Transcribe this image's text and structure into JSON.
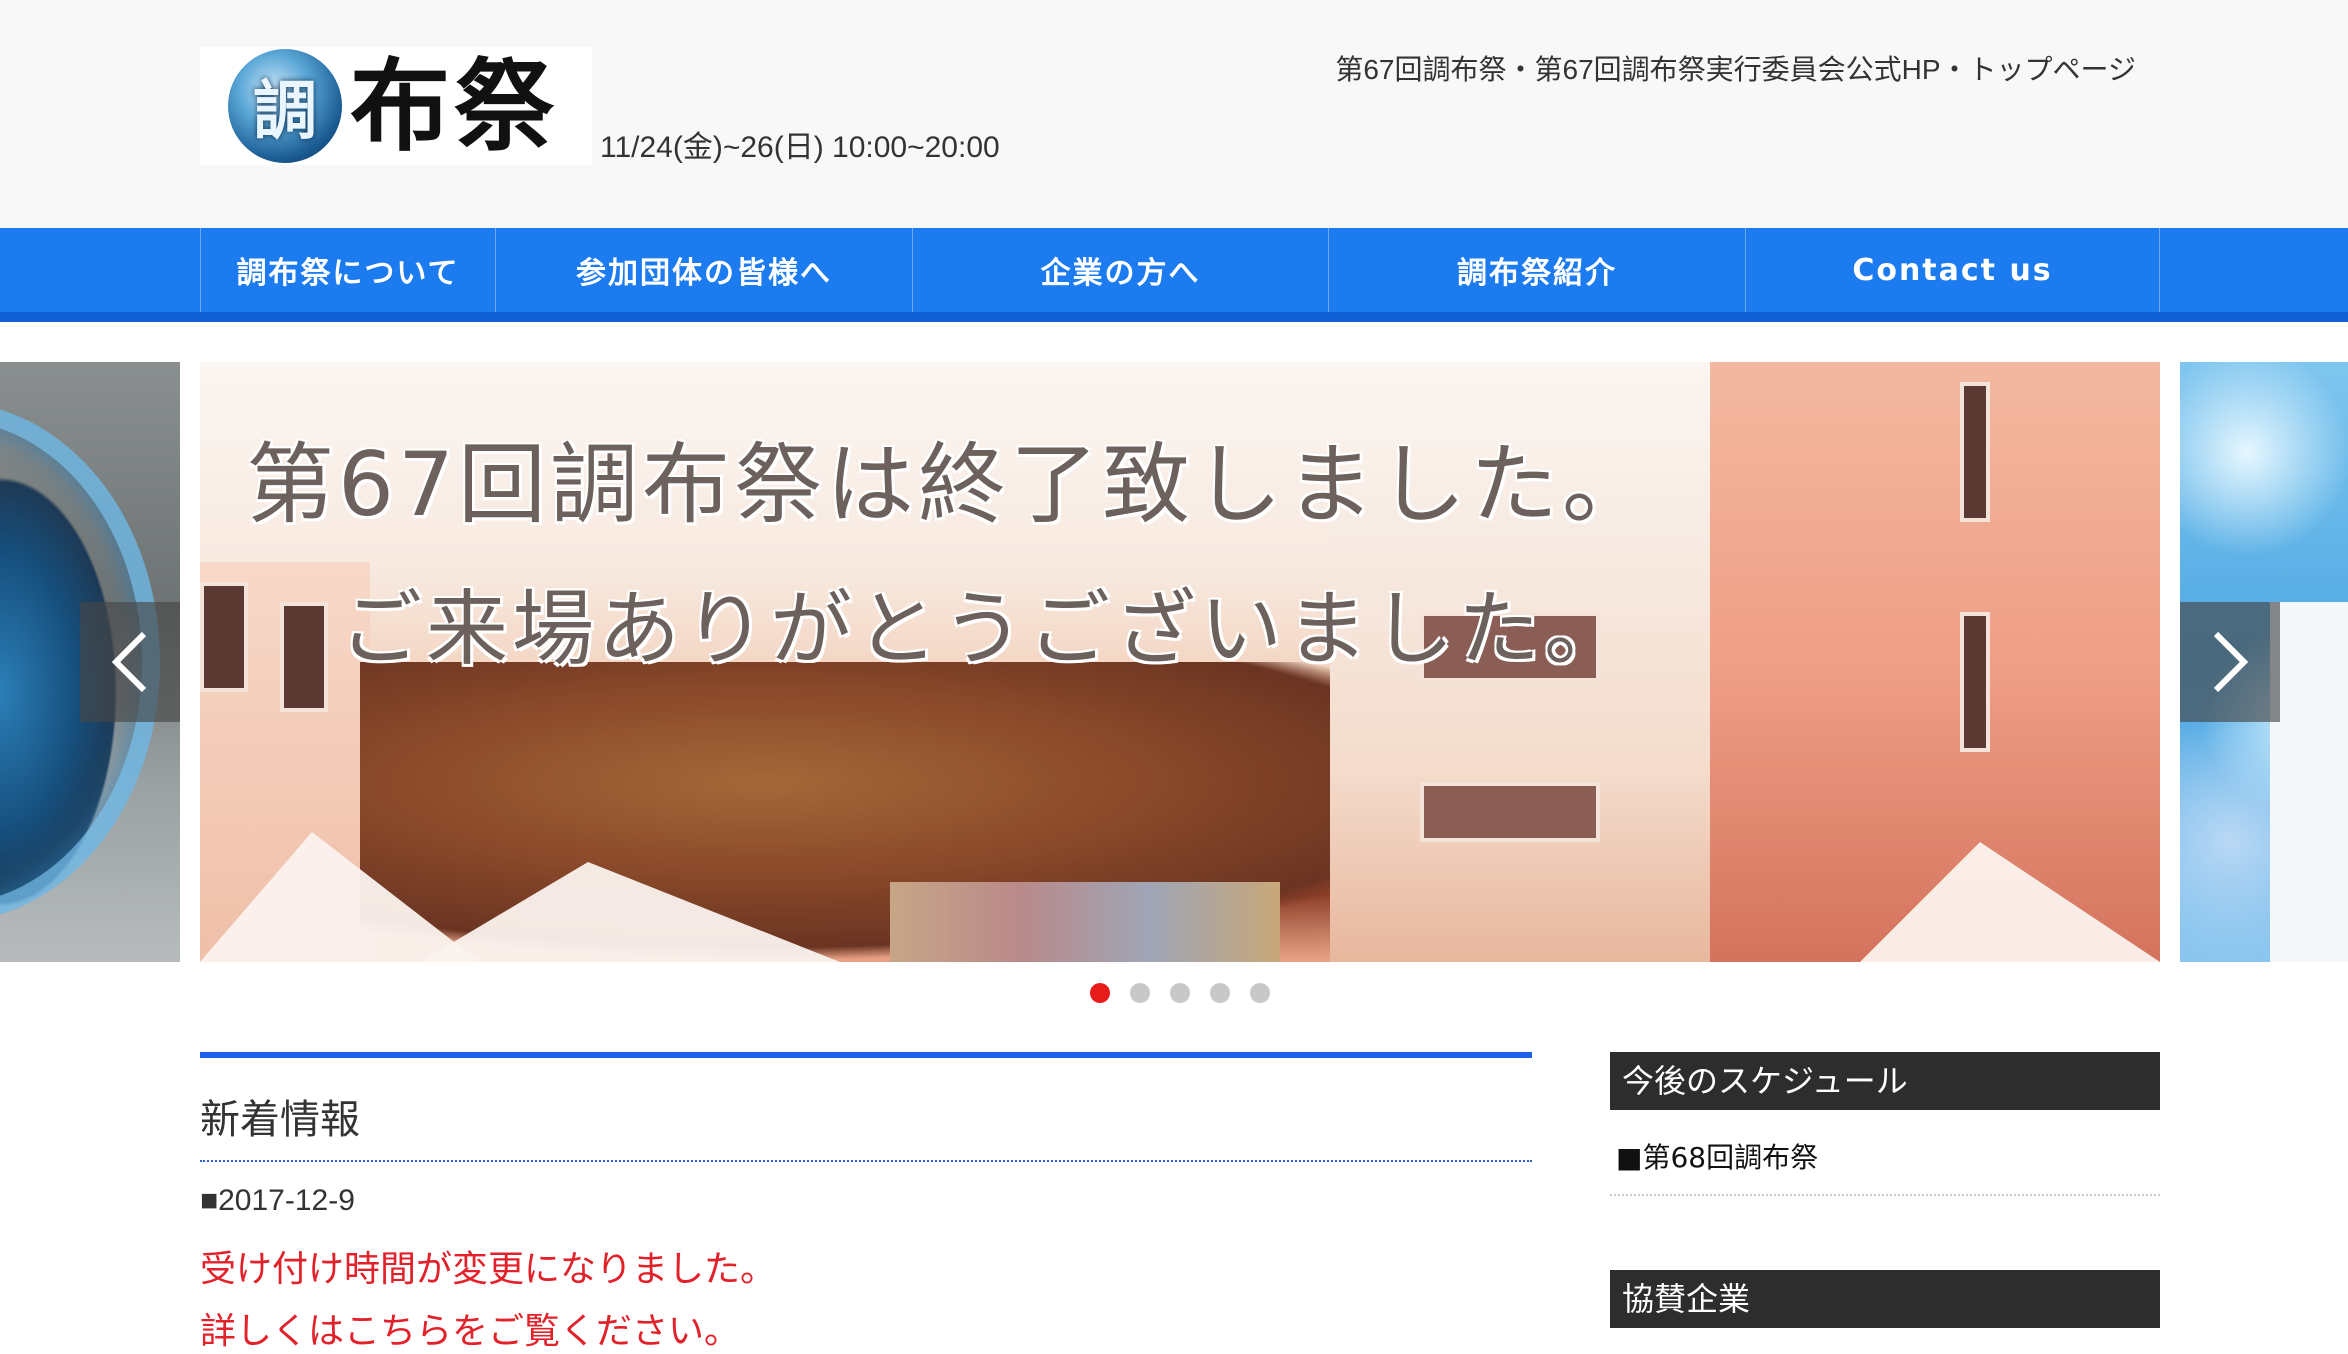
{
  "header": {
    "logo_kanji": "調",
    "logo_text": "布祭",
    "dates": "11/24(金)~26(日) 10:00~20:00",
    "site_description": "第67回調布祭・第67回調布祭実行委員会公式HP・トップページ"
  },
  "nav": {
    "items": [
      {
        "label": "調布祭について"
      },
      {
        "label": "参加団体の皆様へ"
      },
      {
        "label": "企業の方へ"
      },
      {
        "label": "調布祭紹介"
      },
      {
        "label": "Contact us"
      }
    ]
  },
  "slider": {
    "line1": "第67回調布祭は終了致しました。",
    "line2": "ご来場ありがとうございました。",
    "slide_count": 5,
    "active_index": 0,
    "prev_icon": "chevron-left-icon",
    "next_icon": "chevron-right-icon"
  },
  "news": {
    "title": "新着情報",
    "date": "■2017-12-9",
    "headline": "受け付け時間が変更になりました。",
    "subline": "詳しくはこちらをご覧ください。"
  },
  "sidebar": {
    "schedule_heading": "今後のスケジュール",
    "schedule_item": "■第68回調布祭",
    "sponsors_heading": "協賛企業"
  },
  "colors": {
    "nav_blue": "#1d7bf0",
    "accent_red": "#e1222a",
    "dark_heading": "#2d2d2d"
  }
}
